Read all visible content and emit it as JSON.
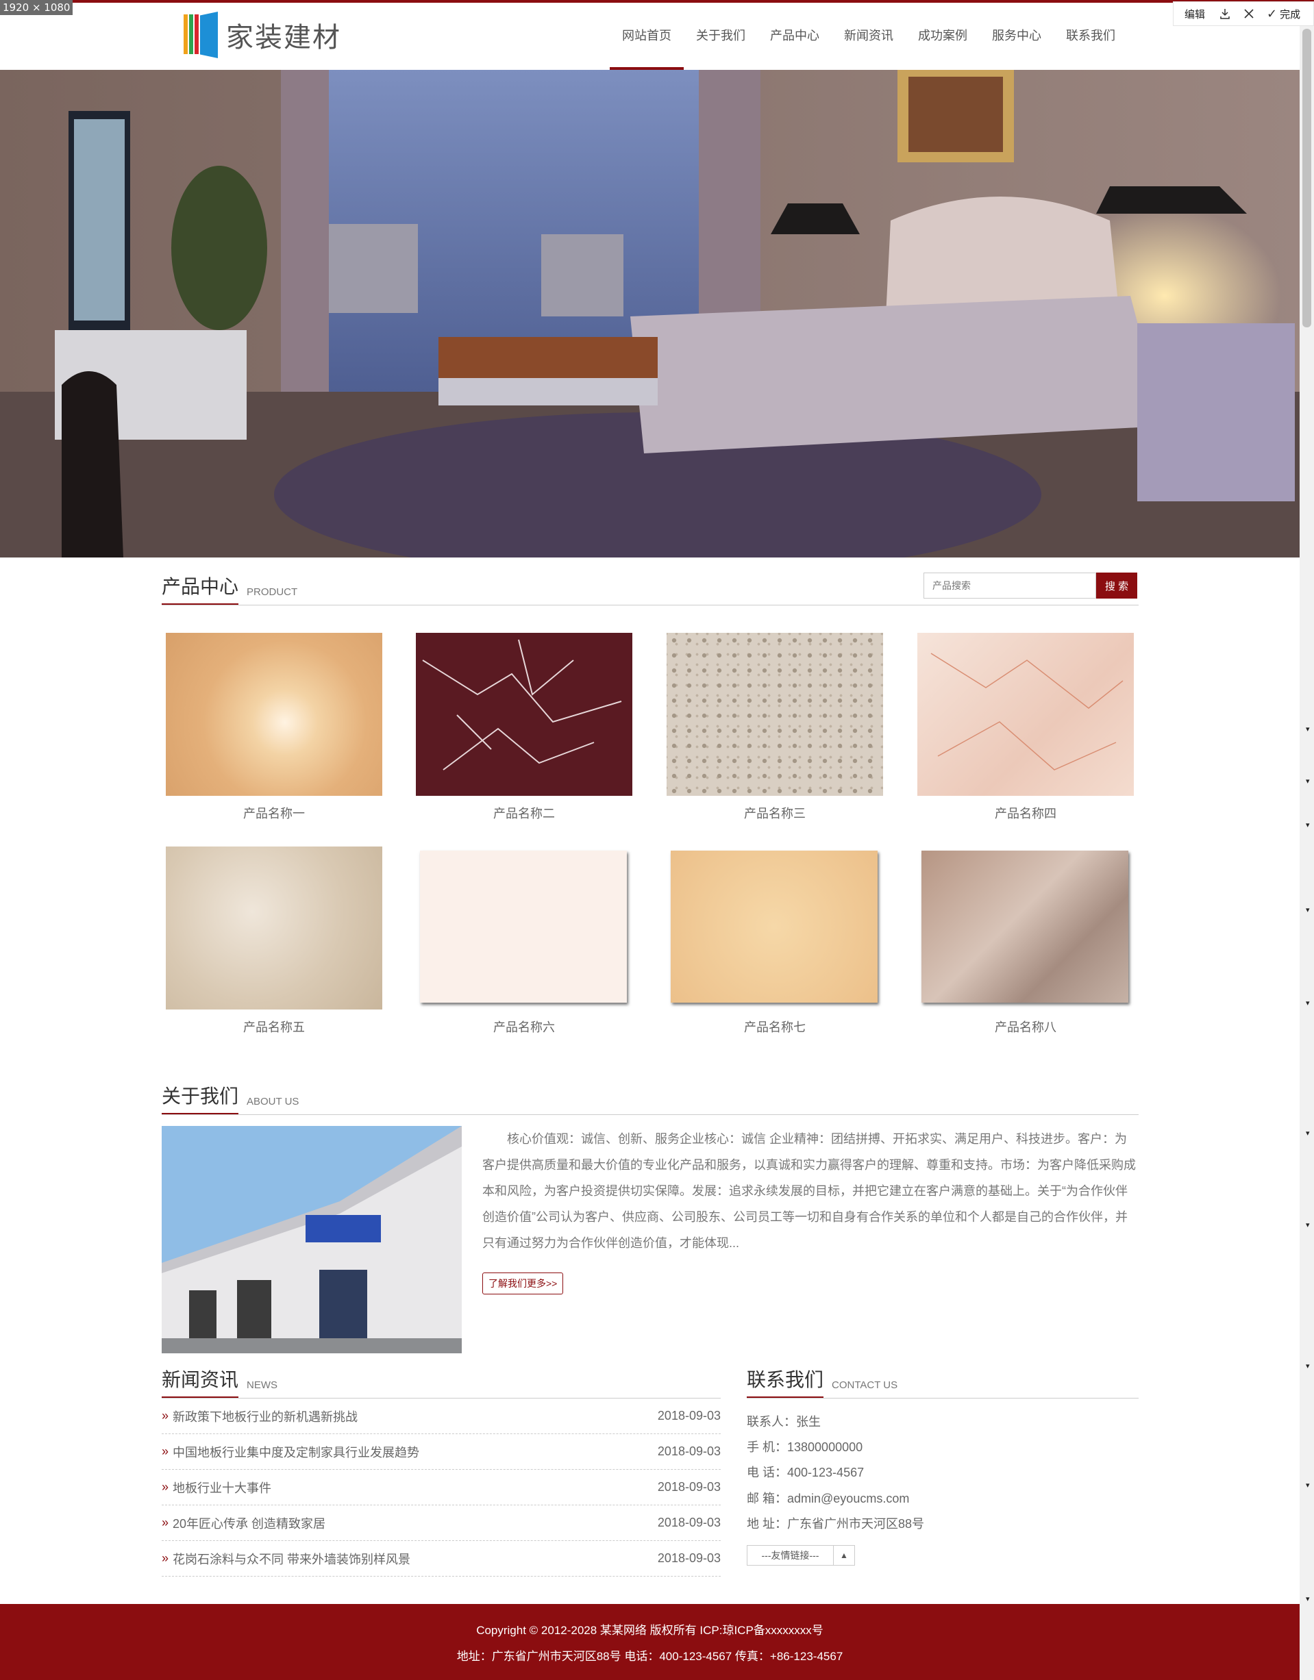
{
  "screenshot_tag": "1920 × 1080",
  "editor_toolbar": {
    "edit": "编辑",
    "done": "完成"
  },
  "brand": {
    "name": "家装建材",
    "accent": "#8b0d10"
  },
  "nav": [
    {
      "label": "网站首页",
      "active": true
    },
    {
      "label": "关于我们"
    },
    {
      "label": "产品中心"
    },
    {
      "label": "新闻资讯"
    },
    {
      "label": "成功案例"
    },
    {
      "label": "服务中心"
    },
    {
      "label": "联系我们"
    }
  ],
  "banner": {
    "slides": 2,
    "active_slide": 2
  },
  "products": {
    "title": "产品中心",
    "subtitle": "PRODUCT",
    "search_placeholder": "产品搜索",
    "search_button": "搜 索",
    "items": [
      {
        "name": "产品名称一"
      },
      {
        "name": "产品名称二"
      },
      {
        "name": "产品名称三"
      },
      {
        "name": "产品名称四"
      },
      {
        "name": "产品名称五"
      },
      {
        "name": "产品名称六"
      },
      {
        "name": "产品名称七"
      },
      {
        "name": "产品名称八"
      }
    ]
  },
  "about": {
    "title": "关于我们",
    "subtitle": "ABOUT US",
    "text": "核心价值观：诚信、创新、服务企业核心：诚信 企业精神：团结拼搏、开拓求实、满足用户、科技进步。客户：为客户提供高质量和最大价值的专业化产品和服务，以真诚和实力赢得客户的理解、尊重和支持。市场：为客户降低采购成本和风险，为客户投资提供切实保障。发展：追求永续发展的目标，并把它建立在客户满意的基础上。关于“为合作伙伴创造价值”公司认为客户、供应商、公司股东、公司员工等一切和自身有合作关系的单位和个人都是自己的合作伙伴，并只有通过努力为合作伙伴创造价值，才能体现...",
    "more_button": "了解我们更多>>"
  },
  "news": {
    "title": "新闻资讯",
    "subtitle": "NEWS",
    "items": [
      {
        "title": "新政策下地板行业的新机遇新挑战",
        "date": "2018-09-03"
      },
      {
        "title": "中国地板行业集中度及定制家具行业发展趋势",
        "date": "2018-09-03"
      },
      {
        "title": "地板行业十大事件",
        "date": "2018-09-03"
      },
      {
        "title": "20年匠心传承 创造精致家居",
        "date": "2018-09-03"
      },
      {
        "title": "花岗石涂料与众不同 带来外墙装饰别样风景",
        "date": "2018-09-03"
      }
    ]
  },
  "contact": {
    "title": "联系我们",
    "subtitle": "CONTACT US",
    "lines": [
      "联系人：张生",
      "手 机：13800000000",
      "电 话：400-123-4567",
      "邮 箱：admin@eyoucms.com",
      "地 址：广东省广州市天河区88号"
    ],
    "links_select": "---友情链接---"
  },
  "footer": {
    "line1": "Copyright © 2012-2028 某某网络 版权所有 ICP:琼ICP备xxxxxxxx号",
    "line2": "地址：广东省广州市天河区88号  电话：400-123-4567  传真：+86-123-4567"
  }
}
